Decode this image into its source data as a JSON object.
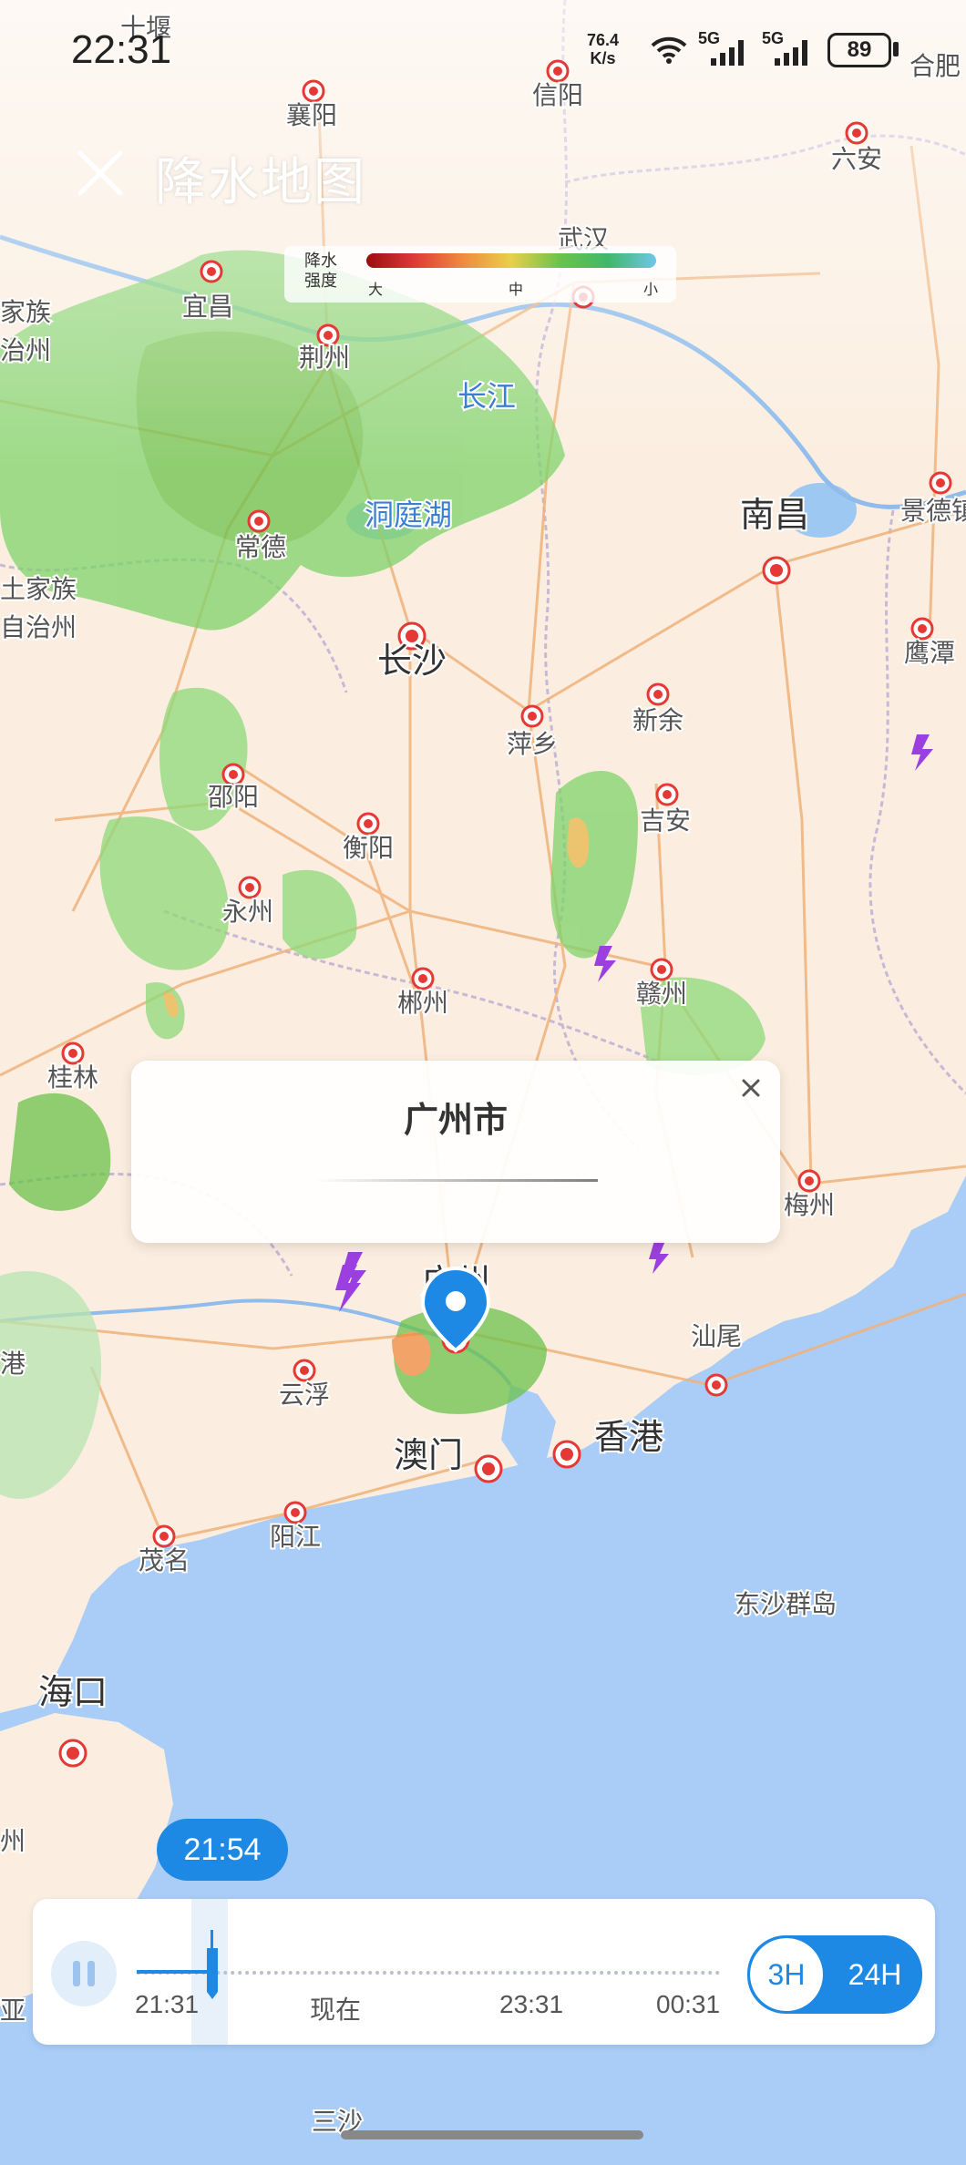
{
  "status_bar": {
    "time": "22:31",
    "net_speed": "76.4",
    "net_unit": "K/s",
    "signal_1": "5G",
    "signal_2": "5G",
    "battery": "89"
  },
  "header": {
    "title": "降水地图",
    "close_icon": "close-icon"
  },
  "legend": {
    "title": "降水强度",
    "ticks": [
      "大",
      "中",
      "小"
    ],
    "colors": [
      "#9a0d0d",
      "#e03a3a",
      "#ef8b3f",
      "#e8d04a",
      "#6cc24b",
      "#3fb86a",
      "#6fc6e8"
    ]
  },
  "map": {
    "cities": [
      {
        "name": "十堰"
      },
      {
        "name": "合肥"
      },
      {
        "name": "襄阳"
      },
      {
        "name": "信阳"
      },
      {
        "name": "六安"
      },
      {
        "name": "宜昌"
      },
      {
        "name": "武汉"
      },
      {
        "name": "荆州"
      },
      {
        "name": "长江"
      },
      {
        "name": "洞庭湖"
      },
      {
        "name": "常德"
      },
      {
        "name": "南昌"
      },
      {
        "name": "景德镇"
      },
      {
        "name": "长沙"
      },
      {
        "name": "新余"
      },
      {
        "name": "萍乡"
      },
      {
        "name": "鹰潭"
      },
      {
        "name": "邵阳"
      },
      {
        "name": "吉安"
      },
      {
        "name": "衡阳"
      },
      {
        "name": "永州"
      },
      {
        "name": "郴州"
      },
      {
        "name": "赣州"
      },
      {
        "name": "桂林"
      },
      {
        "name": "梅州"
      },
      {
        "name": "广州"
      },
      {
        "name": "云浮"
      },
      {
        "name": "汕尾"
      },
      {
        "name": "澳门"
      },
      {
        "name": "香港"
      },
      {
        "name": "阳江"
      },
      {
        "name": "茂名"
      },
      {
        "name": "东沙群岛"
      },
      {
        "name": "海口"
      },
      {
        "name": "三沙"
      },
      {
        "name": "家族"
      },
      {
        "name": "治州"
      },
      {
        "name": "土家族"
      },
      {
        "name": "自治州"
      },
      {
        "name": "港"
      },
      {
        "name": "州"
      },
      {
        "name": "亚"
      }
    ],
    "location_pin": "map-pin-icon",
    "lightning_icon": "lightning-icon"
  },
  "popup": {
    "title": "广州市",
    "close_icon": "close-icon"
  },
  "timeline": {
    "current_time": "21:54",
    "ticks": [
      "21:31",
      "现在",
      "23:31",
      "00:31"
    ],
    "play_state": "pause-icon",
    "progress": 0.13,
    "range_options": [
      "3H",
      "24H"
    ],
    "selected_range": "3H"
  },
  "colors": {
    "accent": "#1e88e5",
    "land": "#fbeee0",
    "sea": "#a9cdf7",
    "road": "#f0b27a",
    "rain_light": "#6cc24b"
  }
}
